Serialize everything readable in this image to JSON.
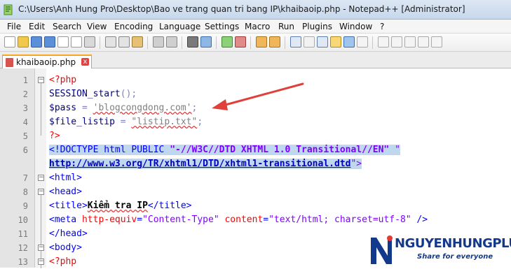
{
  "window": {
    "title": "C:\\Users\\Anh Hung Pro\\Desktop\\Bao ve trang quan tri bang IP\\khaibaoip.php - Notepad++ [Administrator]"
  },
  "menu": [
    "File",
    "Edit",
    "Search",
    "View",
    "Encoding",
    "Language",
    "Settings",
    "Macro",
    "Run",
    "Plugins",
    "Window",
    "?"
  ],
  "tab": {
    "label": "khaibaoip.php",
    "close": "x"
  },
  "editor": {
    "line_numbers": [
      "1",
      "2",
      "3",
      "4",
      "5",
      "6",
      "",
      "7",
      "8",
      "9",
      "10",
      "11",
      "12",
      "13"
    ],
    "lines": {
      "l1": {
        "open": "<?php"
      },
      "l2": {
        "fn": "SESSION_start",
        "rest": "();"
      },
      "l3": {
        "var": "$pass",
        "eq": " = ",
        "str": "'blogcongdong.com'",
        "end": ";"
      },
      "l4": {
        "var": "$file_listip",
        "eq": " = ",
        "str": "\"listip.txt\"",
        "end": ";"
      },
      "l5": {
        "close": "?>"
      },
      "l6": {
        "tag": "<!DOCTYPE html PUBLIC ",
        "val1": "\"-//W3C//DTD XHTML 1.0 Transitional//EN\"",
        "quote": " \""
      },
      "l6b": {
        "url": "http://www.w3.org/TR/xhtml1/DTD/xhtml1-transitional.dtd",
        "end": "\">"
      },
      "l7": {
        "tag": "<html>"
      },
      "l8": {
        "tag": "<head>"
      },
      "l9": {
        "open": "<title>",
        "text": "Kiểm tra IP",
        "close": "</title>"
      },
      "l10": {
        "open": "<meta ",
        "a1": "http-equiv",
        "eq1": "=",
        "v1": "\"Content-Type\"",
        "a2": " content",
        "eq2": "=",
        "v2": "\"text/html; charset=utf-8\"",
        "end": " />"
      },
      "l11": {
        "tag": "</head>"
      },
      "l12": {
        "tag": "<body>"
      },
      "l13": {
        "open": "<?php"
      }
    }
  },
  "watermark": {
    "brand": "NGUYENHUNGPLUS",
    "slogan": "Share for everyone"
  },
  "colors": {
    "arrow": "#e0403a",
    "brand": "#12398c"
  }
}
